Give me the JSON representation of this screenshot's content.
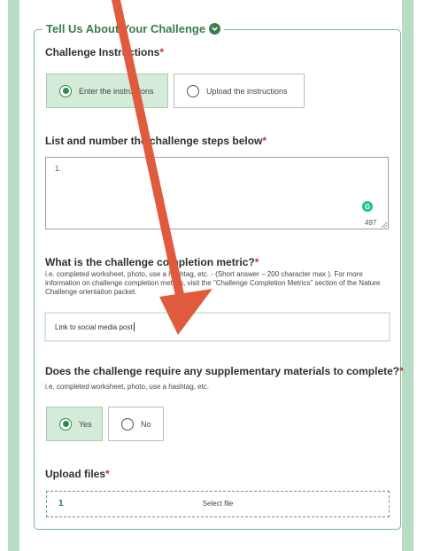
{
  "section": {
    "title": "Tell Us About Your Challenge",
    "toggle_icon": "chevron-down-icon"
  },
  "instructions": {
    "label": "Challenge Instructions",
    "required_mark": "*",
    "options": [
      {
        "label": "Enter the instructions",
        "selected": true
      },
      {
        "label": "Upload the instructions",
        "selected": false
      }
    ]
  },
  "steps": {
    "label": "List and number the challenge steps below",
    "required_mark": "*",
    "value": "1.",
    "remaining_chars": "497",
    "assistant_icon": "grammarly-icon",
    "assistant_glyph": "G"
  },
  "metric": {
    "label": "What is the challenge completion metric?",
    "required_mark": "*",
    "help": "i.e. completed worksheet, photo, use a hashtag, etc. - (Short answer – 200 character max ). For more information on challenge completion metrics, visit the \"Challenge Completion Metrics\" section of the Nature Challenge orientation packet.",
    "value": "Link to social media post"
  },
  "supplementary": {
    "label": "Does the challenge require any supplementary materials to complete?",
    "required_mark": "*",
    "help": "i.e. completed worksheet, photo, use a hashtag, etc.",
    "options": [
      {
        "label": "Yes",
        "selected": true
      },
      {
        "label": "No",
        "selected": false
      }
    ]
  },
  "upload": {
    "label": "Upload files",
    "required_mark": "*",
    "slot_number": "1",
    "select_label": "Select file"
  },
  "annotation": {
    "color": "#e05a3e",
    "icon": "red-arrow-annotation"
  }
}
